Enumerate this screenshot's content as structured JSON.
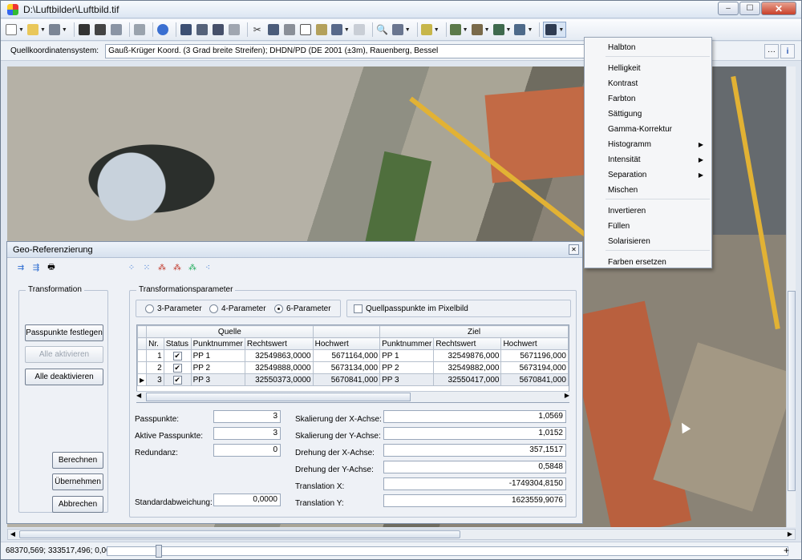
{
  "window": {
    "title": "D:\\Luftbilder\\Luftbild.tif",
    "minimize": "–",
    "maximize": "☐",
    "close": "✕"
  },
  "coordbar": {
    "label": "Quellkoordinatensystem:",
    "value": "Gauß-Krüger Koord. (3 Grad breite Streifen); DHDN/PD (DE 2001 (±3m), Rauenberg, Bessel",
    "more": "···",
    "info": "i"
  },
  "dialog": {
    "title": "Geo-Referenzierung",
    "transformation_group": "Transformation",
    "buttons": {
      "passpunkte": "Passpunkte festlegen",
      "alle_aktivieren": "Alle aktivieren",
      "alle_deaktivieren": "Alle deaktivieren",
      "berechnen": "Berechnen",
      "uebernehmen": "Übernehmen",
      "abbrechen": "Abbrechen"
    },
    "params_group": "Transformationsparameter",
    "radios": {
      "p3": "3-Parameter",
      "p4": "4-Parameter",
      "p6": "6-Parameter",
      "selected": "6-Parameter"
    },
    "checkbox_label": "Quellpasspunkte im Pixelbild",
    "table": {
      "group_source": "Quelle",
      "group_target": "Ziel",
      "headers": [
        "Nr.",
        "Status",
        "Punktnummer",
        "Rechtswert",
        "Hochwert",
        "Punktnummer",
        "Rechtswert",
        "Hochwert"
      ],
      "rows": [
        {
          "nr": "1",
          "status": "✔",
          "p1": "PP 1",
          "r1": "32549863,0000",
          "h1": "5671164,000",
          "p2": "PP 1",
          "r2": "32549876,000",
          "h2": "5671196,000"
        },
        {
          "nr": "2",
          "status": "✔",
          "p1": "PP 2",
          "r1": "32549888,0000",
          "h1": "5673134,000",
          "p2": "PP 2",
          "r2": "32549882,000",
          "h2": "5673194,000"
        },
        {
          "nr": "3",
          "status": "✔",
          "p1": "PP 3",
          "r1": "32550373,0000",
          "h1": "5670841,000",
          "p2": "PP 3",
          "r2": "32550417,000",
          "h2": "5670841,000"
        }
      ]
    },
    "fields": {
      "passpunkte_label": "Passpunkte:",
      "passpunkte": "3",
      "aktive_label": "Aktive Passpunkte:",
      "aktive": "3",
      "redundanz_label": "Redundanz:",
      "redundanz": "0",
      "stdabw_label": "Standardabweichung:",
      "stdabw": "0,0000",
      "skal_x_label": "Skalierung der X-Achse:",
      "skal_x": "1,0569",
      "skal_y_label": "Skalierung der Y-Achse:",
      "skal_y": "1,0152",
      "dreh_x_label": "Drehung der X-Achse:",
      "dreh_x": "357,1517",
      "dreh_y_label": "Drehung der Y-Achse:",
      "dreh_y": "0,5848",
      "trans_x_label": "Translation X:",
      "trans_x": "-1749304,8150",
      "trans_y_label": "Translation Y:",
      "trans_y": "1623559,9076"
    }
  },
  "menu": {
    "items": [
      "Halbton",
      "Helligkeit",
      "Kontrast",
      "Farbton",
      "Sättigung",
      "Gamma-Korrektur",
      "Histogramm",
      "Intensität",
      "Separation",
      "Mischen",
      "Invertieren",
      "Füllen",
      "Solarisieren",
      "Farben ersetzen"
    ]
  },
  "status": {
    "coords": "68370,569; 333517,496; 0,00"
  }
}
